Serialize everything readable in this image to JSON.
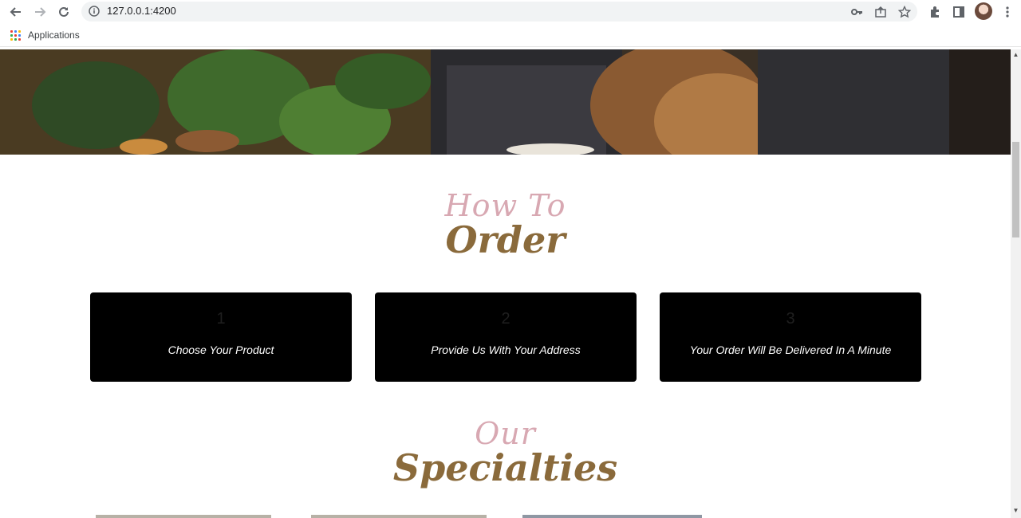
{
  "browser": {
    "url": "127.0.0.1:4200",
    "bookmarks": {
      "apps_label": "Applications"
    }
  },
  "page": {
    "how_to": {
      "top": "How To",
      "bottom": "Order"
    },
    "steps": [
      {
        "number": "1",
        "label": "Choose Your Product"
      },
      {
        "number": "2",
        "label": "Provide Us With Your Address"
      },
      {
        "number": "3",
        "label": "Your Order Will Be Delivered In A Minute"
      }
    ],
    "specialties": {
      "top": "Our",
      "bottom": "Specialties"
    }
  },
  "colors": {
    "accent_brown": "#8a6a3b",
    "accent_pink": "#d8a8b2",
    "card": "#000000"
  }
}
